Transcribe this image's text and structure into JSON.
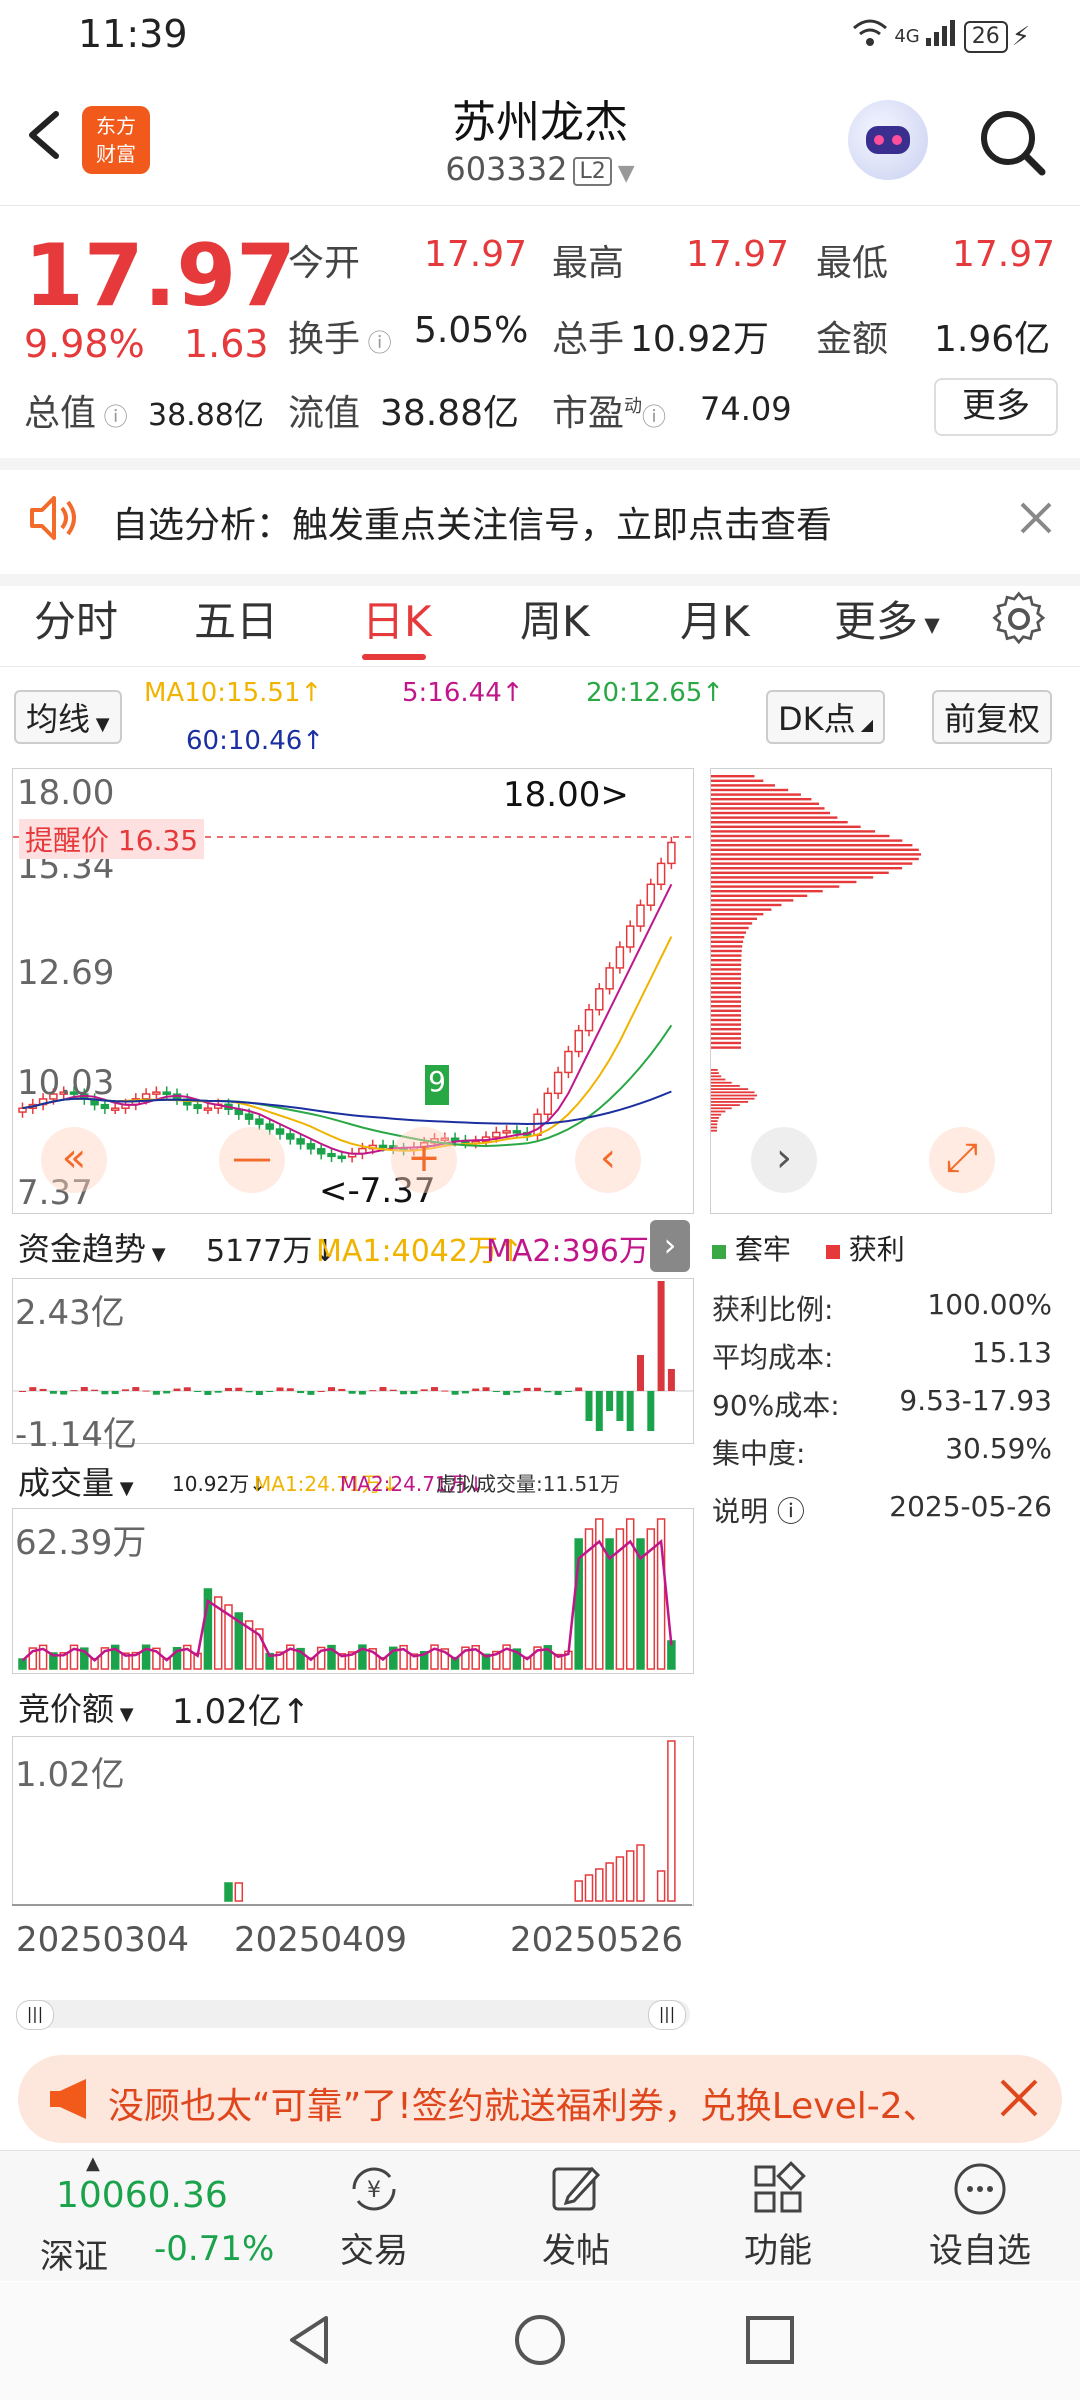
{
  "status_bar": {
    "time": "11:39",
    "network": "4G",
    "battery": "26"
  },
  "header": {
    "logo_line1": "东方",
    "logo_line2": "财富",
    "title": "苏州龙杰",
    "code": "603332",
    "level": "L2"
  },
  "quote": {
    "price": "17.97",
    "change_pct": "9.98%",
    "change": "1.63",
    "fields": [
      {
        "label": "今开",
        "value": "17.97",
        "color": "red"
      },
      {
        "label": "最高",
        "value": "17.97",
        "color": "red"
      },
      {
        "label": "最低",
        "value": "17.97",
        "color": "red"
      },
      {
        "label": "换手",
        "value": "5.05%",
        "color": "black"
      },
      {
        "label": "总手",
        "value": "10.92万",
        "color": "black"
      },
      {
        "label": "金额",
        "value": "1.96亿",
        "color": "black"
      }
    ],
    "total_value_label": "总值",
    "total_value": "38.88亿",
    "float_value_label": "流值",
    "float_value": "38.88亿",
    "pe_label": "市盈",
    "pe_sup": "动",
    "pe": "74.09",
    "more": "更多"
  },
  "notice": {
    "text": "自选分析：触发重点关注信号，立即点击查看"
  },
  "tabs": [
    {
      "label": "分时"
    },
    {
      "label": "五日"
    },
    {
      "label": "日K"
    },
    {
      "label": "周K"
    },
    {
      "label": "月K"
    },
    {
      "label": "更多"
    }
  ],
  "ma_bar": {
    "indicator": "均线",
    "ma10": "MA10:15.51↑",
    "ma5": "5:16.44↑",
    "ma20": "20:12.65↑",
    "ma60": "60:10.46↑",
    "dk": "DK点",
    "adjust": "前复权"
  },
  "kchart": {
    "y_labels": [
      "18.00",
      "15.34",
      "12.69",
      "10.03",
      "7.37"
    ],
    "alert": "提醒价 16.35",
    "high_marker": "18.00>",
    "low_marker": "<-7.37",
    "nine_label": "9",
    "colors": {
      "up": "#e5393b",
      "down": "#1aa34a",
      "ma5": "#c0168a",
      "ma10": "#f0b400",
      "ma20": "#2aa845",
      "ma60": "#1c2fa0"
    }
  },
  "fund": {
    "indicator": "资金趋势",
    "v1": "5177万↓",
    "ma1": "MA1:4042万↑",
    "ma2": "MA2:396万↑",
    "top": "2.43亿",
    "bottom": "-1.14亿"
  },
  "volume": {
    "indicator": "成交量",
    "v": "10.92万↓",
    "ma1": "MA1:24.71万↓",
    "ma2": "MA2:24.71万↓",
    "virtual": "虚拟成交量:11.51万",
    "top": "62.39万"
  },
  "auction": {
    "indicator": "竞价额",
    "v": "1.02亿↑",
    "top": "1.02亿"
  },
  "dates": [
    "20250304",
    "20250409",
    "20250526"
  ],
  "chips": {
    "legend_trapped": "套牢",
    "legend_profit": "获利",
    "stats": [
      {
        "label": "获利比例:",
        "value": "100.00%"
      },
      {
        "label": "平均成本:",
        "value": "15.13"
      },
      {
        "label": "90%成本:",
        "value": "9.53-17.93"
      },
      {
        "label": "集中度:",
        "value": "30.59%"
      }
    ],
    "note_label": "说明",
    "note_date": "2025-05-26"
  },
  "banner": {
    "text": "没顾也太“可靠”了!签约就送福利券，兑换Level-2、"
  },
  "bottom_nav": {
    "index_value": "10060.36",
    "index_name": "深证",
    "index_change": "-0.71%",
    "items": [
      {
        "label": "交易"
      },
      {
        "label": "发帖"
      },
      {
        "label": "功能"
      },
      {
        "label": "设自选"
      }
    ]
  }
}
